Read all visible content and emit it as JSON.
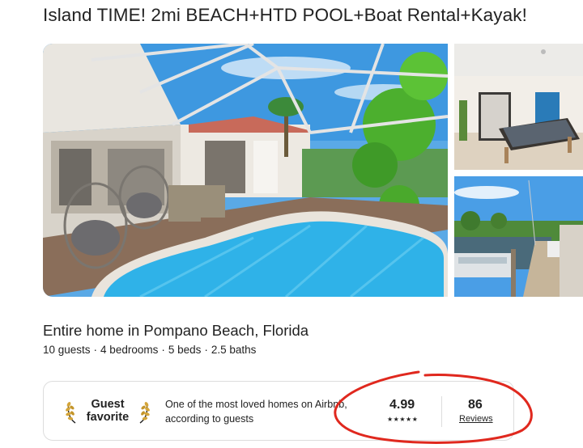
{
  "listing": {
    "title": "Island TIME! 2mi BEACH+HTD POOL+Boat Rental+Kayak!",
    "subtitle": "Entire home in Pompano Beach, Florida",
    "details": [
      "10 guests",
      "4 bedrooms",
      "5 beds",
      "2.5 baths"
    ],
    "detail_separator": "·"
  },
  "badge": {
    "guest_favorite": "Guest favorite",
    "description": "One of the most loved homes on Airbnb, according to guests",
    "rating": "4.99",
    "stars": "★★★★★",
    "reviews_count": "86",
    "reviews_label": "Reviews"
  },
  "photos": [
    {
      "name": "pool-patio-photo"
    },
    {
      "name": "game-room-photo"
    },
    {
      "name": "canal-dock-photo"
    }
  ],
  "colors": {
    "text": "#222222",
    "border": "#dddddd",
    "annotation": "#e0281e",
    "pool": "#2fb2e8",
    "sky": "#3d9de6"
  }
}
